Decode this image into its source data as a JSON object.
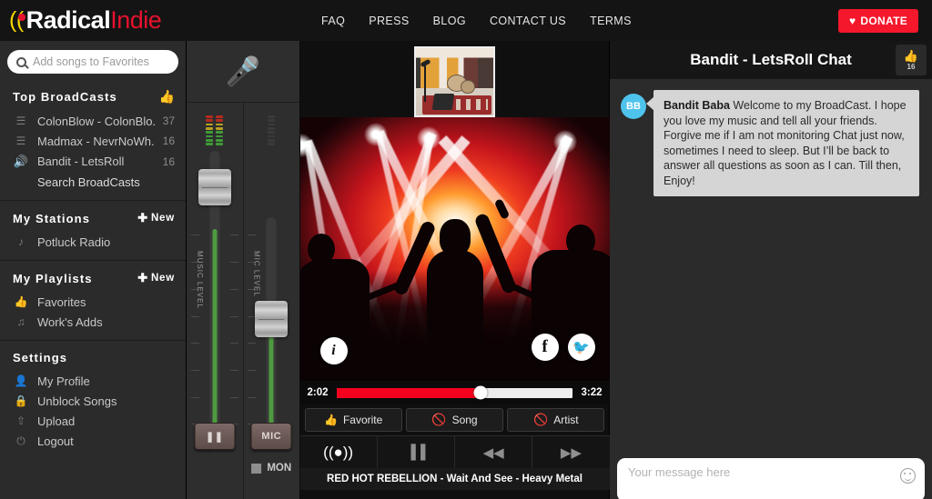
{
  "header": {
    "logo": {
      "wave_icon": "broadcast-wave-icon",
      "word1": "Radical",
      "word2": "Indie"
    },
    "nav": [
      {
        "label": "FAQ"
      },
      {
        "label": "PRESS"
      },
      {
        "label": "BLOG"
      },
      {
        "label": "CONTACT US"
      },
      {
        "label": "TERMS"
      }
    ],
    "donate": {
      "label": "DONATE",
      "icon": "heart-icon",
      "color": "#f5172b"
    }
  },
  "sidebar": {
    "search": {
      "placeholder": "Add songs to Favorites",
      "value": "",
      "icon": "search-icon"
    },
    "sections": [
      {
        "title": "Top BroadCasts",
        "action_icon": "thumbs-up-icon",
        "items": [
          {
            "icon": "broadcast-tower-icon",
            "label": "ColonBlow - ColonBlo...",
            "count": "37",
            "active": false
          },
          {
            "icon": "broadcast-tower-icon",
            "label": "Madmax - NevrNoWh...",
            "count": "16",
            "active": false
          },
          {
            "icon": "speaker-icon",
            "label": "Bandit - LetsRoll",
            "count": "16",
            "active": true
          }
        ],
        "footer_link": "Search BroadCasts"
      },
      {
        "title": "My Stations",
        "new_label": "New",
        "items": [
          {
            "icon": "music-note-icon",
            "label": "Potluck Radio",
            "count": "",
            "active": false
          }
        ]
      },
      {
        "title": "My Playlists",
        "new_label": "New",
        "items": [
          {
            "icon": "thumbs-up-icon",
            "label": "Favorites",
            "count": "",
            "active": false
          },
          {
            "icon": "playlist-icon",
            "label": "Work's Adds",
            "count": "",
            "active": false
          }
        ]
      },
      {
        "title": "Settings",
        "items": [
          {
            "icon": "user-icon",
            "label": "My Profile",
            "count": "",
            "active": false
          },
          {
            "icon": "lock-icon",
            "label": "Unblock Songs",
            "count": "",
            "active": false
          },
          {
            "icon": "upload-icon",
            "label": "Upload",
            "count": "",
            "active": false
          },
          {
            "icon": "power-icon",
            "label": "Logout",
            "count": "",
            "active": false
          }
        ]
      }
    ]
  },
  "mixer": {
    "mic_icon": "microphone-icon",
    "music_channel": {
      "label": "MUSIC LEVEL",
      "meter_lit": true,
      "fader_percent": 92,
      "button": {
        "label": "",
        "icon": "pause-icon"
      }
    },
    "mic_channel": {
      "label": "MIC LEVEL",
      "meter_lit": false,
      "fader_percent": 55,
      "button": {
        "label": "MIC",
        "icon": "mic-icon"
      }
    },
    "monitor": {
      "label": "MON",
      "icon": "monitor-square-icon",
      "enabled": false
    }
  },
  "player": {
    "webcam": {
      "name": "webcam-thumbnail",
      "alt": "rehearsal studio with drum kit and amp"
    },
    "artwork": {
      "name": "album-artwork",
      "alt": "concert crowd silhouettes with stage lights"
    },
    "artwork_buttons": [
      {
        "name": "info-button",
        "icon": "info-icon",
        "label": "i"
      },
      {
        "name": "facebook-share-button",
        "icon": "facebook-icon",
        "label": "f"
      },
      {
        "name": "twitter-share-button",
        "icon": "twitter-icon",
        "label": "🐦"
      }
    ],
    "progress": {
      "elapsed": "2:02",
      "duration": "3:22",
      "percent": 61,
      "fill_color": "#f5001e"
    },
    "actions": [
      {
        "label": "Favorite",
        "icon": "thumbs-up-icon"
      },
      {
        "label": "Song",
        "icon": "ban-icon"
      },
      {
        "label": "Artist",
        "icon": "ban-icon"
      }
    ],
    "transport": [
      {
        "name": "live-broadcast-button",
        "icon": "on-air-icon",
        "glyph": "((●))",
        "active": true
      },
      {
        "name": "pause-button",
        "icon": "pause-icon",
        "glyph": "▐▐",
        "active": false
      },
      {
        "name": "previous-button",
        "icon": "previous-icon",
        "glyph": "◀◀",
        "active": false
      },
      {
        "name": "next-button",
        "icon": "next-icon",
        "glyph": "▶▶",
        "active": false
      }
    ],
    "now_playing": "RED HOT REBELLION - Wait And See - Heavy Metal"
  },
  "chat": {
    "title": "Bandit - LetsRoll Chat",
    "like": {
      "icon": "thumbs-up-icon",
      "count": "16"
    },
    "messages": [
      {
        "avatar_initials": "BB",
        "avatar_color": "#4ec3ec",
        "author": "Bandit Baba",
        "text": "Welcome to my BroadCast. I hope you love my music and tell all your friends. Forgive me if I am not monitoring Chat just now, sometimes I need to sleep. But I’ll be back to answer all questions as soon as I can. Till then, Enjoy!"
      }
    ],
    "input": {
      "placeholder": "Your message here",
      "value": "",
      "emoji_icon": "smiley-icon"
    }
  }
}
